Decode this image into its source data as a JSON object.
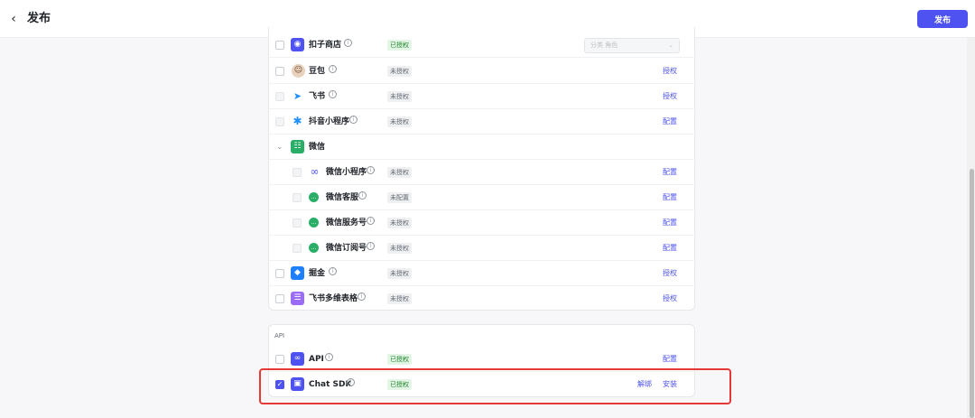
{
  "header": {
    "title": "发布",
    "publish_label": "发布",
    "back_icon": "chevron-left-icon"
  },
  "filter": {
    "placeholder": "分类  角色"
  },
  "channels": [
    {
      "name": "扣子商店",
      "status": "已授权",
      "status_kind": "ok",
      "action": "",
      "icon": "coze-store-icon",
      "color": "#4e52f0"
    },
    {
      "name": "豆包",
      "status": "未授权",
      "status_kind": "no",
      "action": "授权",
      "icon": "doubao-avatar-icon",
      "color": "#d8b08c"
    },
    {
      "name": "飞书",
      "status": "未授权",
      "status_kind": "no",
      "action": "授权",
      "icon": "feishu-icon",
      "color": "#1f8fff"
    },
    {
      "name": "抖音小程序",
      "status": "未授权",
      "status_kind": "no",
      "action": "配置",
      "icon": "douyin-miniapp-icon",
      "color": "#1f8fff"
    }
  ],
  "wechat": {
    "name": "微信",
    "icon": "wechat-icon",
    "items": [
      {
        "name": "微信小程序",
        "status": "未授权",
        "action": "配置",
        "icon": "wechat-miniapp-icon"
      },
      {
        "name": "微信客服",
        "status": "未配置",
        "action": "配置",
        "icon": "wechat-service-icon"
      },
      {
        "name": "微信服务号",
        "status": "未授权",
        "action": "配置",
        "icon": "wechat-official-icon"
      },
      {
        "name": "微信订阅号",
        "status": "未授权",
        "action": "配置",
        "icon": "wechat-subscription-icon"
      }
    ]
  },
  "more_channels": [
    {
      "name": "掘金",
      "status": "未授权",
      "action": "授权",
      "icon": "juejin-icon",
      "color": "#1e80ff"
    },
    {
      "name": "飞书多维表格",
      "status": "未授权",
      "action": "授权",
      "icon": "feishu-bitable-icon",
      "color": "#9b6cf5"
    }
  ],
  "api_section": {
    "label": "API",
    "items": [
      {
        "name": "API",
        "status": "已授权",
        "actions": [
          "配置"
        ],
        "icon": "api-link-icon",
        "checked": false
      },
      {
        "name": "Chat SDK",
        "status": "已授权",
        "actions": [
          "解绑",
          "安装"
        ],
        "icon": "chat-sdk-icon",
        "checked": true
      }
    ]
  },
  "colors": {
    "accent": "#4e52f0",
    "ok_bg": "#e3f5e5",
    "ok_text": "#20872f",
    "highlight": "#e53935"
  }
}
